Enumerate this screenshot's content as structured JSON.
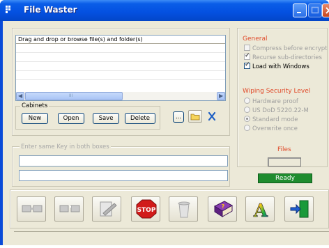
{
  "window": {
    "title": "File Waster"
  },
  "files": {
    "column_header": "Drag and drop or browse file(s) and folder(s)",
    "scroll_thumb_grip": "III"
  },
  "cabinets": {
    "label": "Cabinets",
    "buttons": [
      "New",
      "Open",
      "Save",
      "Delete"
    ],
    "browse_label": "..."
  },
  "key": {
    "legend": "Enter same Key in both boxes",
    "key1_value": "",
    "key2_value": ""
  },
  "general": {
    "title": "General",
    "options": [
      {
        "label": "Compress before encrypt",
        "checked": false,
        "enabled": false
      },
      {
        "label": "Recurse sub-directories",
        "checked": true,
        "enabled": false
      },
      {
        "label": "Load with Windows",
        "checked": true,
        "enabled": true
      }
    ]
  },
  "wiping": {
    "title": "Wiping Security Level",
    "options": [
      {
        "label": "Hardware proof",
        "selected": false
      },
      {
        "label": "US DoD 5220.22-M",
        "selected": false
      },
      {
        "label": "Standard mode",
        "selected": true
      },
      {
        "label": "Overwrite once",
        "selected": false
      }
    ]
  },
  "files_counter": {
    "title": "Files",
    "value": ""
  },
  "status": {
    "text": "Ready",
    "color": "#1f8c2f"
  },
  "toolbar": {
    "icons": [
      "encrypt-icon",
      "decrypt-icon",
      "wipe-icon",
      "stop-icon",
      "recycle-bin-icon",
      "help-book-icon",
      "about-icon",
      "exit-icon"
    ],
    "stop_label": "STOP",
    "about_label": "A"
  },
  "colors": {
    "titlebar": "#0a5de8",
    "accent_red": "#e04a2a",
    "face": "#ece9d8"
  }
}
